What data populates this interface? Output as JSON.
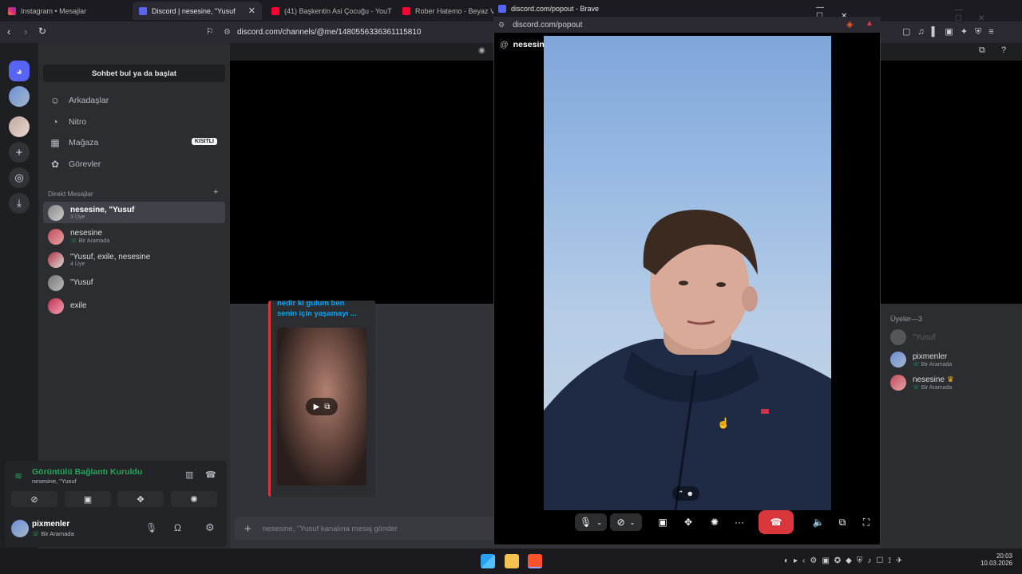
{
  "browser": {
    "tabs": [
      {
        "label": "Instagram • Mesajlar"
      },
      {
        "label": "Discord | nesesine, \"Yusuf"
      },
      {
        "label": "(41) Başkentin Asi Çocuğu - YouT"
      },
      {
        "label": "Rober Hatemo - Beyaz Ve Se"
      }
    ],
    "url": "discord.com/channels/@me/1480556336361115810"
  },
  "popout": {
    "window_title": "discord.com/popout - Brave",
    "url": "discord.com/popout",
    "call_name": "nesesine, \"Yusuf"
  },
  "sidebar": {
    "find_label": "Sohbet bul ya da başlat",
    "nav": [
      {
        "label": "Arkadaşlar",
        "icon": "friends-icon"
      },
      {
        "label": "Nitro",
        "icon": "nitro-icon"
      },
      {
        "label": "Mağaza",
        "icon": "shop-icon",
        "badge": "KISITLI"
      },
      {
        "label": "Görevler",
        "icon": "quests-icon"
      }
    ],
    "dm_header": "Direkt Mesajlar",
    "dms": [
      {
        "name": "nesesine, \"Yusuf",
        "sub": "3 Üye",
        "active": true
      },
      {
        "name": "nesesine",
        "sub": "Bir Aramada"
      },
      {
        "name": "\"Yusuf, exile, nesesine",
        "sub": "4 Üye"
      },
      {
        "name": "\"Yusuf",
        "sub": ""
      },
      {
        "name": "exile",
        "sub": ""
      }
    ],
    "voice": {
      "status": "Görüntülü Bağlantı Kuruldu",
      "channel": "nesesine, \"Yusuf"
    },
    "user": {
      "name": "pixmenler",
      "status": "Bir Aramada"
    }
  },
  "chat": {
    "embed_text_1": "nedir ki gulum ben",
    "embed_text_2": "senin için yaşamayı ...",
    "placeholder": "nesesine, \"Yusuf kanalına mesaj gönder"
  },
  "members": {
    "header": "Üyeler—3",
    "list": [
      {
        "name": "\"Yusuf",
        "sub": ""
      },
      {
        "name": "pixmenler",
        "sub": "Bir Aramada"
      },
      {
        "name": "nesesine",
        "sub": "Bir Aramada"
      }
    ]
  },
  "taskbar": {
    "time": "20:03",
    "date": "10.03.2026"
  },
  "colors": {
    "accent": "#5865f2",
    "danger": "#da373c",
    "online": "#23a55a"
  }
}
